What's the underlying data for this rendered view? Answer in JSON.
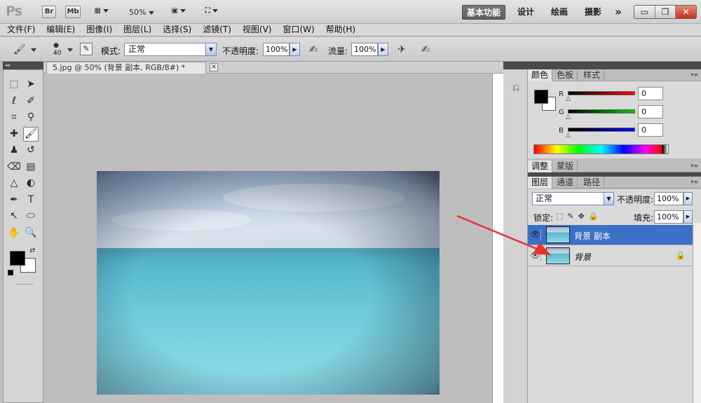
{
  "app": {
    "logo": "Ps",
    "bridge_label": "Br",
    "minibridge_label": "Mb",
    "zoom": "50%",
    "workspaces": [
      "基本功能",
      "设计",
      "绘画",
      "摄影"
    ],
    "more": "»",
    "window_controls": [
      "▭",
      "❐",
      "✕"
    ]
  },
  "menu": [
    "文件(F)",
    "编辑(E)",
    "图像(I)",
    "图层(L)",
    "选择(S)",
    "滤镜(T)",
    "视图(V)",
    "窗口(W)",
    "帮助(H)"
  ],
  "options": {
    "brush_size": "40",
    "mode_label": "模式:",
    "mode_value": "正常",
    "opacity_label": "不透明度:",
    "opacity_value": "100%",
    "flow_label": "流量:",
    "flow_value": "100%"
  },
  "document": {
    "tab_title": "5.jpg @ 50% (背景 副本, RGB/8#) *",
    "close": "×"
  },
  "color_panel": {
    "tabs": [
      "颜色",
      "色板",
      "样式"
    ],
    "channels": [
      {
        "label": "R",
        "value": "0",
        "color": "#ff0000"
      },
      {
        "label": "G",
        "value": "0",
        "color": "#00cc00"
      },
      {
        "label": "B",
        "value": "0",
        "color": "#0000ff"
      }
    ]
  },
  "adjust_panel": {
    "tabs": [
      "调整",
      "蒙版"
    ]
  },
  "layers_panel": {
    "tabs": [
      "图层",
      "通道",
      "路径"
    ],
    "blend_mode": "正常",
    "opacity_label": "不透明度:",
    "opacity_value": "100%",
    "lock_label": "锁定:",
    "fill_label": "填充:",
    "fill_value": "100%",
    "layers": [
      {
        "name": "背景 副本",
        "selected": true,
        "locked": false
      },
      {
        "name": "背景",
        "selected": false,
        "locked": true
      }
    ]
  },
  "colors": {
    "selection_blue": "#3c6fc6",
    "annotation_arrow": "#e8322c"
  }
}
